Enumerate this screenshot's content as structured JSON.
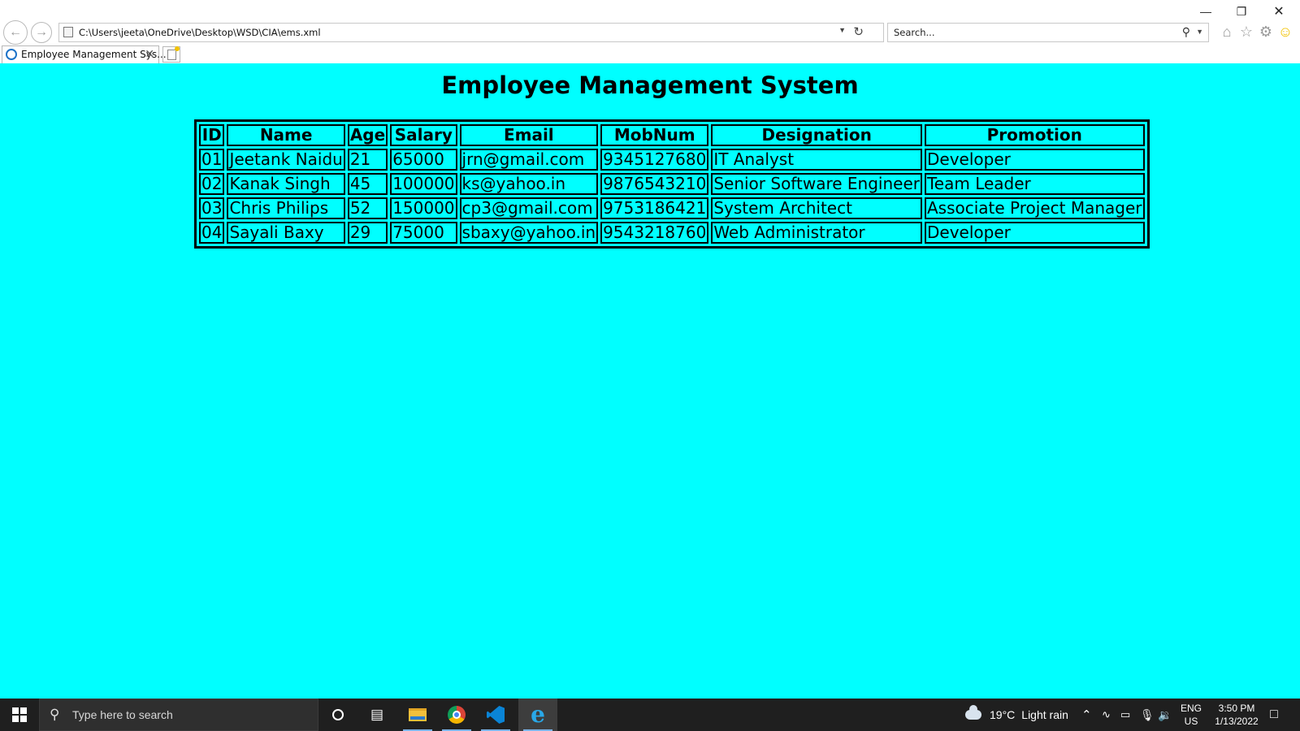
{
  "browser": {
    "tab_title": "Employee Management Sys...",
    "address": "C:\\Users\\jeeta\\OneDrive\\Desktop\\WSD\\CIA\\ems.xml",
    "search_placeholder": "Search..."
  },
  "page": {
    "background": "#00ffff",
    "title": "Employee Management System",
    "columns": [
      "ID",
      "Name",
      "Age",
      "Salary",
      "Email",
      "MobNum",
      "Designation",
      "Promotion"
    ],
    "rows": [
      [
        "01",
        "Jeetank Naidu",
        "21",
        "65000",
        "jrn@gmail.com",
        "9345127680",
        "IT Analyst",
        "Developer"
      ],
      [
        "02",
        "Kanak Singh",
        "45",
        "100000",
        "ks@yahoo.in",
        "9876543210",
        "Senior Software Engineer",
        "Team Leader"
      ],
      [
        "03",
        "Chris Philips",
        "52",
        "150000",
        "cp3@gmail.com",
        "9753186421",
        "System Architect",
        "Associate Project Manager"
      ],
      [
        "04",
        "Sayali Baxy",
        "29",
        "75000",
        "sbaxy@yahoo.in",
        "9543218760",
        "Web Administrator",
        "Developer"
      ]
    ]
  },
  "taskbar": {
    "search_placeholder": "Type here to search",
    "weather_temp": "19°C",
    "weather_text": "Light rain",
    "lang": "ENG",
    "region": "US",
    "time": "3:50 PM",
    "date": "1/13/2022",
    "pinned_icons": [
      "cortana-icon",
      "task-view-icon",
      "file-explorer-icon",
      "chrome-icon",
      "vscode-icon",
      "internet-explorer-icon"
    ]
  }
}
